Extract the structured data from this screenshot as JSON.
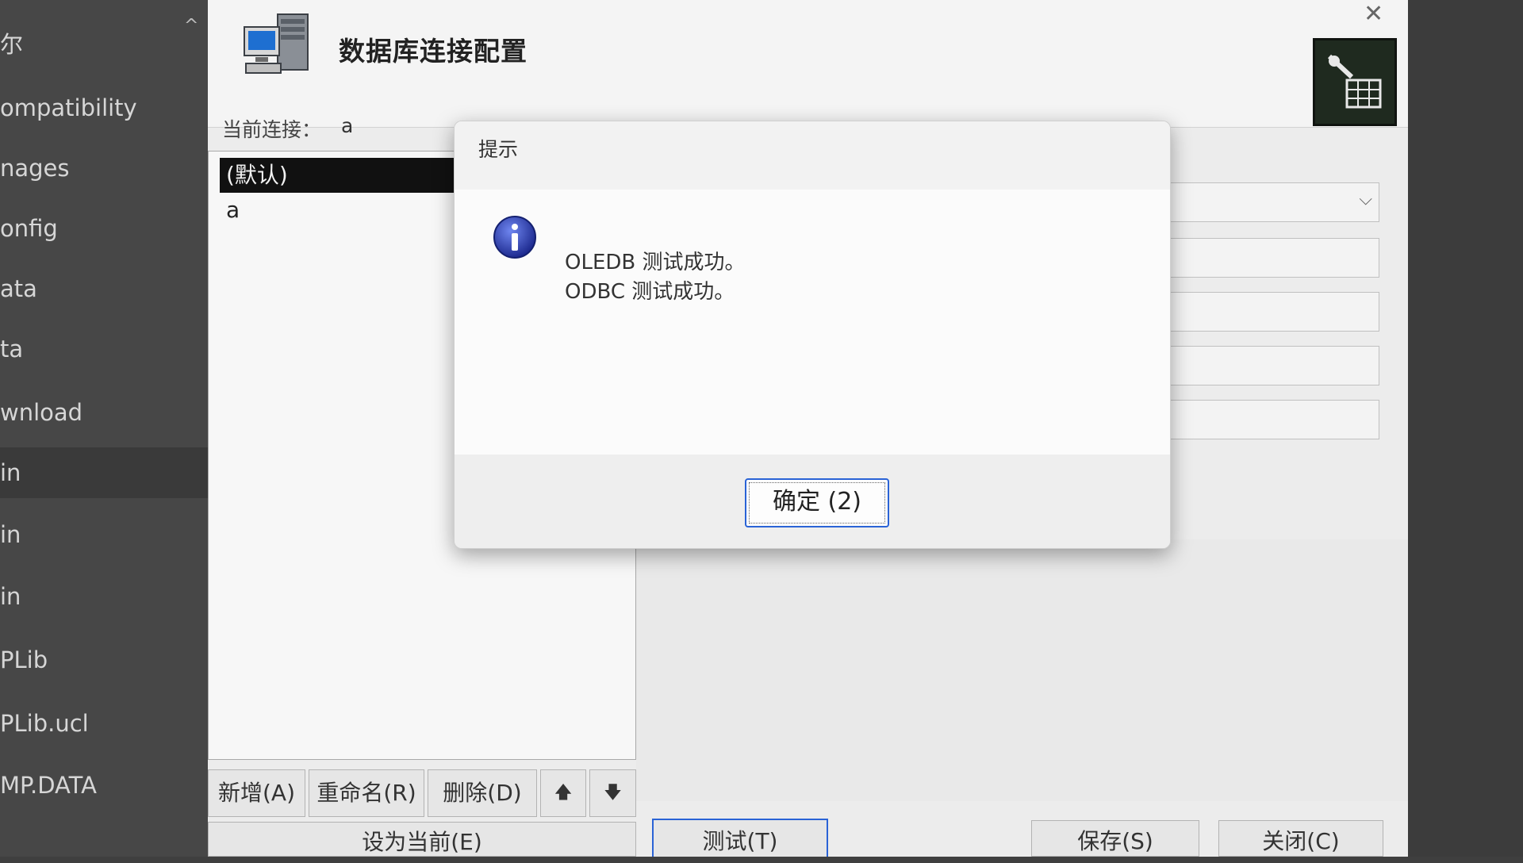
{
  "explorer": {
    "items": [
      {
        "label": "尔"
      },
      {
        "label": "ompatibility"
      },
      {
        "label": "nages"
      },
      {
        "label": "onfig"
      },
      {
        "label": "ata"
      },
      {
        "label": "ta"
      },
      {
        "label": "wnload"
      },
      {
        "label": "in"
      },
      {
        "label": "in"
      },
      {
        "label": "in"
      },
      {
        "label": "PLib"
      },
      {
        "label": "PLib.ucl"
      },
      {
        "label": "MP.DATA"
      }
    ]
  },
  "main_window": {
    "title": "数据库连接配置",
    "close_glyph": "✕",
    "current_connection_label": "当前连接：",
    "current_connection_value": "a",
    "connections": [
      {
        "label": "(默认)",
        "selected": true
      },
      {
        "label": "a",
        "selected": false
      }
    ],
    "list_buttons": {
      "add": "新增(A)",
      "rename": "重命名(R)",
      "delete": "删除(D)",
      "move_up": "🡅",
      "move_down": "🡇"
    },
    "set_current_button": "设为当前(E)",
    "test_button": "测试(T)",
    "save_button": "保存(S)",
    "close_button": "关闭(C)"
  },
  "dialog": {
    "title": "提示",
    "icon": "info-icon",
    "messages": [
      "OLEDB 测试成功。",
      "ODBC 测试成功。"
    ],
    "ok_button": "确定 (2)"
  },
  "colors": {
    "selection_bg": "#111111",
    "ok_border": "#2a63d6",
    "info_icon": "#2b3aa8"
  }
}
